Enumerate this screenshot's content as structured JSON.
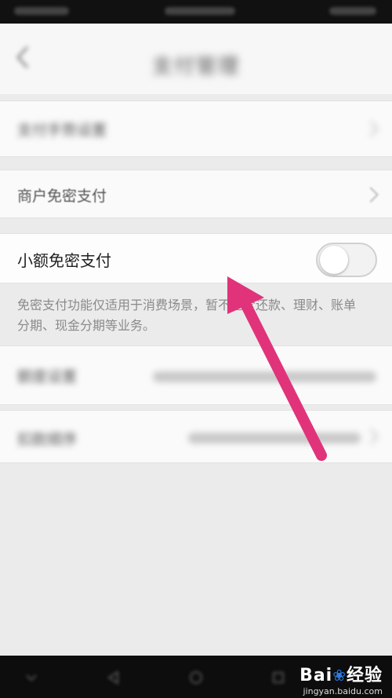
{
  "status_bar": {},
  "nav": {
    "title": "支付管理"
  },
  "rows": {
    "fingerprint": {
      "label": "支付手势设置"
    },
    "merchant": {
      "label": "商户免密支付"
    },
    "small_amount": {
      "label": "小额免密支付",
      "toggle_on": false
    },
    "limit": {
      "label": "额度设置"
    },
    "priority": {
      "label": "扣款顺序"
    }
  },
  "note": "免密支付功能仅适用于消费场景，暂不包含还款、理财、账单分期、现金分期等业务。",
  "watermark": {
    "brand": "Bai",
    "brand_suffix": "经验",
    "site": "jingyan.baidu.com"
  },
  "colors": {
    "arrow": "#e0337a",
    "toggle_border": "#d0d0d0"
  }
}
